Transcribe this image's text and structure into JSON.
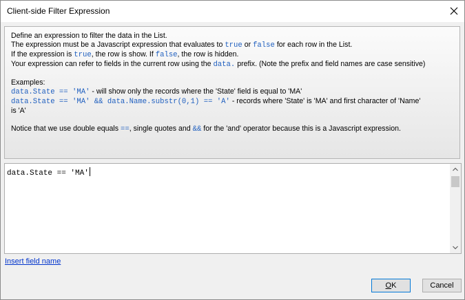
{
  "window": {
    "title": "Client-side Filter Expression"
  },
  "help": {
    "line1": "Define an expression to filter the data in the List.",
    "line2_a": "The expression must be a Javascript expression that evaluates to ",
    "line2_true": "true",
    "line2_or": " or ",
    "line2_false": "false",
    "line2_b": " for each row in the List.",
    "line3_a": "If the expression is ",
    "line3_true": "true",
    "line3_b": ", the row is show. If ",
    "line3_false": "false",
    "line3_c": ", the row is hidden.",
    "line4_a": "Your expression can refer to fields in the current row using the ",
    "line4_code": "data.",
    "line4_b": " prefix. (Note the prefix and field names are case sensitive)",
    "examples_label": "Examples:",
    "ex1_code": "data.State == 'MA'",
    "ex1_text": " - will show only the records where the 'State' field is equal to 'MA'",
    "ex2_code": "data.State == 'MA' && data.Name.substr(0,1) == 'A'",
    "ex2_text": " - records where 'State' is 'MA' and first character of 'Name'",
    "ex2_text2": "is 'A'",
    "notice_a": "Notice that we use double equals ",
    "notice_eq": "==",
    "notice_b": ", single quotes and ",
    "notice_and": "&&",
    "notice_c": " for the 'and' operator because this is a Javascript expression."
  },
  "editor": {
    "value": "data.State == 'MA'"
  },
  "link": {
    "insert_field": "Insert field name"
  },
  "buttons": {
    "ok_mnemonic": "O",
    "ok_rest": "K",
    "cancel": "Cancel"
  },
  "colors": {
    "code": "#1f5fbf",
    "link": "#0033cc",
    "accent": "#0078d7"
  }
}
